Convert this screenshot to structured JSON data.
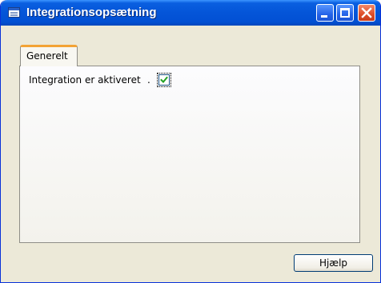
{
  "window": {
    "title": "Integrationsopsætning",
    "icon": "table-icon",
    "controls": [
      "minimize",
      "maximize",
      "close"
    ]
  },
  "tabs": [
    {
      "label": "Generelt",
      "active": true
    }
  ],
  "form": {
    "fields": [
      {
        "label": "Integration er aktiveret",
        "separator": ".",
        "type": "checkbox",
        "checked": true
      }
    ]
  },
  "footer": {
    "help_label": "Hjælp"
  },
  "colors": {
    "titlebar": "#0455d8",
    "tab_accent": "#f3a335",
    "close_button": "#dd4d27",
    "dialog_background": "#ece9d8"
  }
}
